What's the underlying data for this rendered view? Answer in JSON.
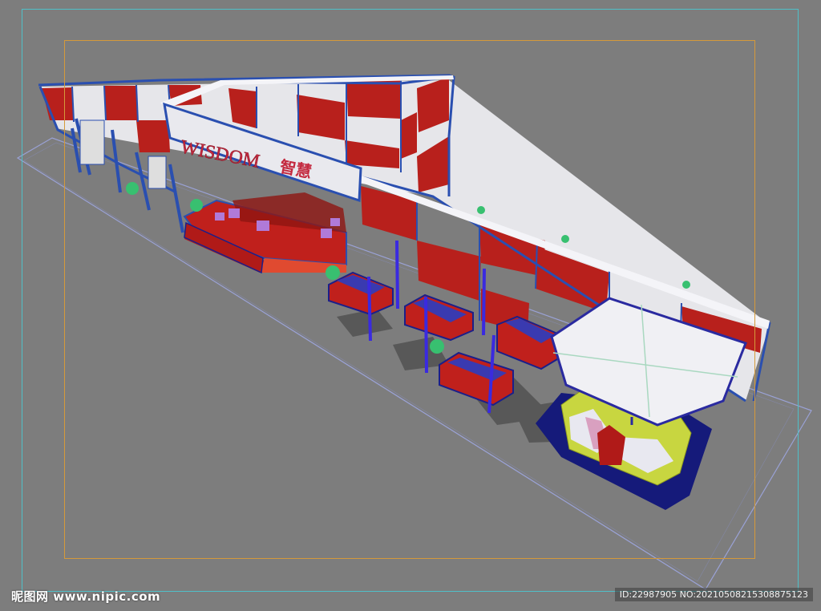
{
  "scene": {
    "sign_latin": "WISDOM",
    "sign_cjk": "智慧"
  },
  "watermark": {
    "site": "昵图网 www.nipic.com",
    "id_text": "ID:22987905 NO:20210508215308875123"
  },
  "colors": {
    "viewport_bg": "#7d7d7d",
    "wall_red": "#b8201c",
    "wall_white": "#e6e6ea",
    "frame_blue": "#2a4fb0",
    "canopy": "#f0f0f4",
    "booth_yellow": "#c8d640",
    "base_navy": "#151a7a"
  }
}
